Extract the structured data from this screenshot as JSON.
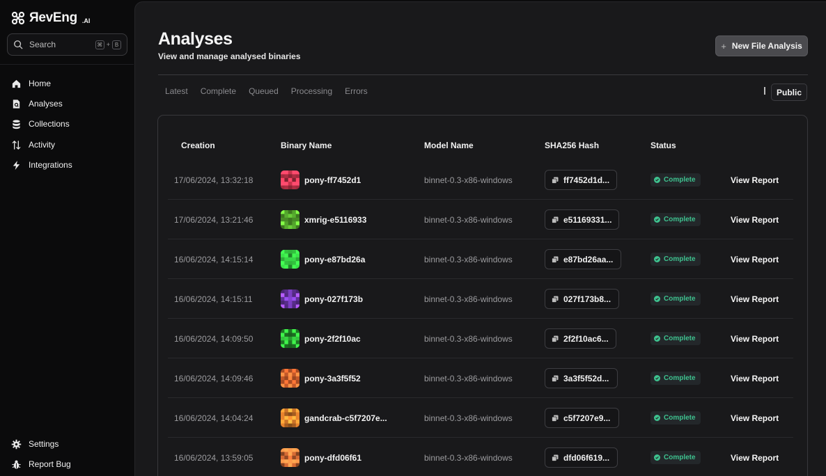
{
  "app": {
    "brand": "ЯevEng",
    "brand_suffix": ".AI"
  },
  "search": {
    "label": "Search",
    "shortcut_mod": "⌘",
    "shortcut_plus": "+",
    "shortcut_key": "B"
  },
  "sidebar": {
    "items": [
      {
        "label": "Home",
        "icon": "home-icon"
      },
      {
        "label": "Analyses",
        "icon": "analyses-icon"
      },
      {
        "label": "Collections",
        "icon": "collections-icon"
      },
      {
        "label": "Activity",
        "icon": "activity-icon"
      },
      {
        "label": "Integrations",
        "icon": "integrations-icon"
      }
    ],
    "bottom": [
      {
        "label": "Settings",
        "icon": "gear-icon"
      },
      {
        "label": "Report Bug",
        "icon": "bug-icon"
      }
    ]
  },
  "header": {
    "title": "Analyses",
    "subtitle": "View and manage analysed binaries",
    "new_button": "New File Analysis",
    "new_button_icon": "plus-icon"
  },
  "tabs": [
    "Latest",
    "Complete",
    "Queued",
    "Processing",
    "Errors"
  ],
  "visibility_button": "Public",
  "table": {
    "columns": [
      "Creation",
      "Binary Name",
      "Model Name",
      "SHA256 Hash",
      "Status"
    ],
    "rows": [
      {
        "date": "17/06/2024, 13:32:18",
        "name": "pony-ff7452d1",
        "model": "binnet-0.3-x86-windows",
        "hash": "ff7452d1d...",
        "status": "Complete",
        "action": "View Report",
        "avatar_color": "#c2324a"
      },
      {
        "date": "17/06/2024, 13:21:46",
        "name": "xmrig-e5116933",
        "model": "binnet-0.3-x86-windows",
        "hash": "e51169331...",
        "status": "Complete",
        "action": "View Report",
        "avatar_color": "#5cb531"
      },
      {
        "date": "16/06/2024, 14:15:14",
        "name": "pony-e87bd26a",
        "model": "binnet-0.3-x86-windows",
        "hash": "e87bd26aa...",
        "status": "Complete",
        "action": "View Report",
        "avatar_color": "#2fb33a"
      },
      {
        "date": "16/06/2024, 14:15:11",
        "name": "pony-027f173b",
        "model": "binnet-0.3-x86-windows",
        "hash": "027f173b8...",
        "status": "Complete",
        "action": "View Report",
        "avatar_color": "#7a3ec0"
      },
      {
        "date": "16/06/2024, 14:09:50",
        "name": "pony-2f2f10ac",
        "model": "binnet-0.3-x86-windows",
        "hash": "2f2f10ac6...",
        "status": "Complete",
        "action": "View Report",
        "avatar_color": "#2aa232"
      },
      {
        "date": "16/06/2024, 14:09:46",
        "name": "pony-3a3f5f52",
        "model": "binnet-0.3-x86-windows",
        "hash": "3a3f5f52d...",
        "status": "Complete",
        "action": "View Report",
        "avatar_color": "#d9622e"
      },
      {
        "date": "16/06/2024, 14:04:24",
        "name": "gandcrab-c5f7207e...",
        "model": "binnet-0.3-x86-windows",
        "hash": "c5f7207e9...",
        "status": "Complete",
        "action": "View Report",
        "avatar_color": "#e2802c"
      },
      {
        "date": "16/06/2024, 13:59:05",
        "name": "pony-dfd06f61",
        "model": "binnet-0.3-x86-windows",
        "hash": "dfd06f619...",
        "status": "Complete",
        "action": "View Report",
        "avatar_color": "#e06f36"
      }
    ]
  },
  "colors": {
    "status_complete": "#3ec28f",
    "panel": "#19191b",
    "sidebar": "#0b0b0c"
  }
}
